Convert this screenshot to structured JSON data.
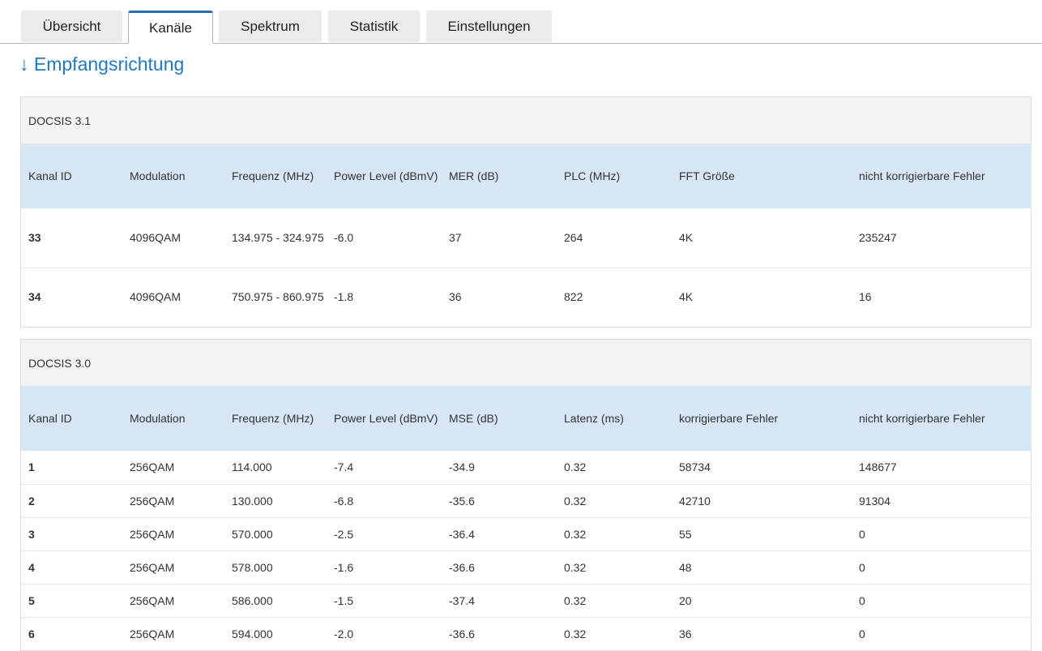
{
  "tabs": [
    "Übersicht",
    "Kanäle",
    "Spektrum",
    "Statistik",
    "Einstellungen"
  ],
  "active_tab": "Kanäle",
  "section_title": "↓ Empfangsrichtung",
  "docsis31": {
    "caption": "DOCSIS 3.1",
    "headers": [
      "Kanal ID",
      "Modulation",
      "Frequenz (MHz)",
      "Power Level (dBmV)",
      "MER (dB)",
      "PLC (MHz)",
      "FFT Größe",
      "nicht korrigierbare Fehler"
    ],
    "rows": [
      [
        "33",
        "4096QAM",
        "134.975 - 324.975",
        "-6.0",
        "37",
        "264",
        "4K",
        "235247"
      ],
      [
        "34",
        "4096QAM",
        "750.975 - 860.975",
        "-1.8",
        "36",
        "822",
        "4K",
        "16"
      ]
    ]
  },
  "docsis30": {
    "caption": "DOCSIS 3.0",
    "headers": [
      "Kanal ID",
      "Modulation",
      "Frequenz (MHz)",
      "Power Level (dBmV)",
      "MSE (dB)",
      "Latenz (ms)",
      "korrigierbare Fehler",
      "nicht korrigierbare Fehler"
    ],
    "rows": [
      [
        "1",
        "256QAM",
        "114.000",
        "-7.4",
        "-34.9",
        "0.32",
        "58734",
        "148677"
      ],
      [
        "2",
        "256QAM",
        "130.000",
        "-6.8",
        "-35.6",
        "0.32",
        "42710",
        "91304"
      ],
      [
        "3",
        "256QAM",
        "570.000",
        "-2.5",
        "-36.4",
        "0.32",
        "55",
        "0"
      ],
      [
        "4",
        "256QAM",
        "578.000",
        "-1.6",
        "-36.6",
        "0.32",
        "48",
        "0"
      ],
      [
        "5",
        "256QAM",
        "586.000",
        "-1.5",
        "-37.4",
        "0.32",
        "20",
        "0"
      ],
      [
        "6",
        "256QAM",
        "594.000",
        "-2.0",
        "-36.6",
        "0.32",
        "36",
        "0"
      ]
    ]
  },
  "colors": {
    "accent": "#1f7ac4",
    "header_bg": "#d6e6f5",
    "caption_bg": "#f4f3f2"
  }
}
